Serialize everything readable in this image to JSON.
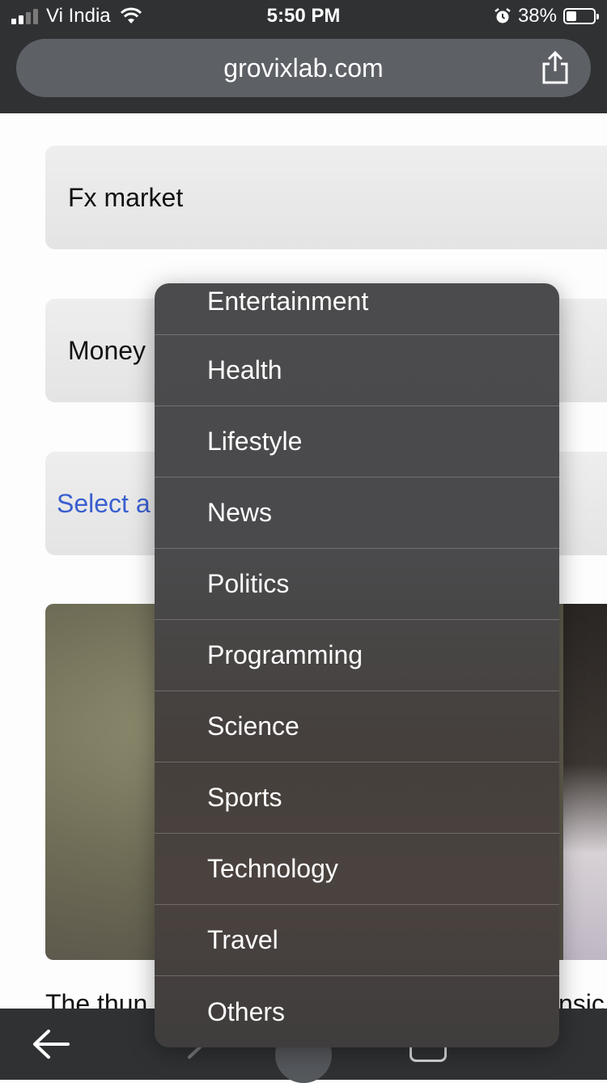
{
  "status_bar": {
    "carrier": "Vi India",
    "time": "5:50 PM",
    "battery_percent": "38%",
    "battery_level": 0.38,
    "signal_bars_active": 2,
    "signal_bars_total": 4,
    "icons": [
      "signal-icon",
      "wifi-icon",
      "alarm-icon",
      "battery-icon"
    ]
  },
  "browser": {
    "url": "grovixlab.com",
    "share_icon": "share-icon"
  },
  "form": {
    "field_1_value": "Fx market",
    "field_2_value": "Money",
    "select_placeholder": "Select a"
  },
  "article": {
    "text_fragment_left": "The thun",
    "text_fragment_right": "nsic"
  },
  "dropdown": {
    "options": [
      "Entertainment",
      "Health",
      "Lifestyle",
      "News",
      "Politics",
      "Programming",
      "Science",
      "Sports",
      "Technology",
      "Travel",
      "Others"
    ]
  },
  "toolbar": {
    "icons": [
      "back-arrow-icon",
      "forward-arrow-icon",
      "home-icon",
      "tabs-icon",
      "more-icon"
    ]
  },
  "colors": {
    "chrome_bg": "#2f3133",
    "url_pill": "#5d6166",
    "select_link": "#3a5fcf",
    "menu_bg": "#4a4a4c"
  }
}
